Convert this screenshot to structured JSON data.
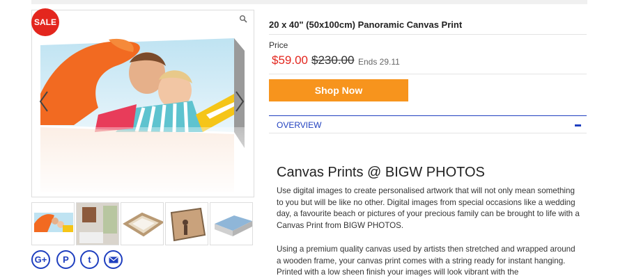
{
  "gallery": {
    "sale_badge": "SALE",
    "zoom_icon": "magnifier-icon",
    "prev_icon": "chevron-left-icon",
    "next_icon": "chevron-right-icon",
    "thumbnails": [
      "canvas-family-thumb",
      "canvas-room-thumb",
      "canvas-frame-back-thumb",
      "canvas-beach-thumb",
      "canvas-stack-thumb"
    ]
  },
  "social": {
    "buttons": [
      {
        "name": "google-plus-icon",
        "glyph": "G+"
      },
      {
        "name": "pinterest-icon",
        "glyph": "P"
      },
      {
        "name": "twitter-icon",
        "glyph": "t"
      },
      {
        "name": "email-icon",
        "glyph": "@"
      }
    ]
  },
  "product": {
    "title": "20 x 40\" (50x100cm) Panoramic Canvas Print",
    "price_label": "Price",
    "price_now": "$59.00",
    "price_was": "$230.00",
    "price_ends": "Ends 29.11",
    "shop_button": "Shop Now"
  },
  "overview": {
    "label": "OVERVIEW",
    "heading": "Canvas Prints @ BIGW PHOTOS",
    "paragraph1": "Use digital images to create personalised artwork that will not only mean something to you but will be like no other. Digital images from special occasions like a wedding day, a favourite beach or pictures of your precious family can be brought to life with a Canvas Print from BIGW PHOTOS.",
    "paragraph2": "Using a premium quality canvas used by artists then stretched and wrapped around a wooden frame, your canvas print comes with a string ready for instant hanging. Printed with a low sheen finish your images will look vibrant with the"
  },
  "colors": {
    "sale_red": "#e3261e",
    "shop_orange": "#f7941d",
    "link_blue": "#1f3fbf"
  }
}
